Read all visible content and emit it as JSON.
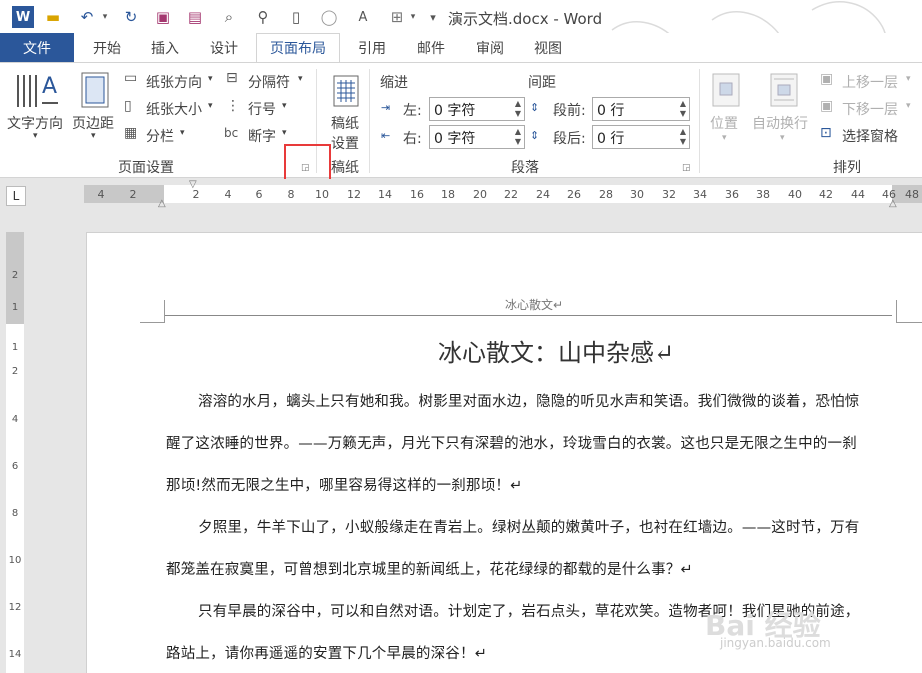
{
  "titlebar": {
    "doc_title": "演示文档.docx - Word",
    "quick_access": [
      "word-logo-icon",
      "open-icon",
      "undo-icon",
      "redo-icon",
      "save-icon",
      "save-as-icon",
      "print-preview-icon",
      "find-icon",
      "new-icon",
      "circle-icon",
      "style-icon",
      "border-icon",
      "customize-icon"
    ]
  },
  "tabs": {
    "file": "文件",
    "items": [
      "开始",
      "插入",
      "设计",
      "页面布局",
      "引用",
      "邮件",
      "审阅",
      "视图"
    ],
    "active": "页面布局"
  },
  "ribbon": {
    "page_setup": {
      "text_direction": "文字方向",
      "margins": "页边距",
      "orientation": "纸张方向",
      "size": "纸张大小",
      "columns": "分栏",
      "breaks": "分隔符",
      "line_numbers": "行号",
      "hyphenation": "断字",
      "group_label": "页面设置"
    },
    "draft": {
      "line1": "稿纸",
      "line2": "设置",
      "group_label": "稿纸"
    },
    "paragraph": {
      "indent_title": "缩进",
      "spacing_title": "间距",
      "left_label": "左:",
      "left_value": "0 字符",
      "right_label": "右:",
      "right_value": "0 字符",
      "before_label": "段前:",
      "before_value": "0 行",
      "after_label": "段后:",
      "after_value": "0 行",
      "group_label": "段落"
    },
    "arrange": {
      "position": "位置",
      "wrap": "自动换行",
      "bring_forward": "上移一层",
      "send_backward": "下移一层",
      "selection_pane": "选择窗格",
      "group_label": "排列"
    }
  },
  "ruler": {
    "tab_selector": "L",
    "h_left": [
      "4",
      "2"
    ],
    "h_right": [
      "2",
      "4",
      "6",
      "8",
      "10",
      "12",
      "14",
      "16",
      "18",
      "20",
      "22",
      "24",
      "26",
      "28",
      "30",
      "32",
      "34",
      "36",
      "38",
      "40",
      "42",
      "44",
      "46",
      "48"
    ],
    "v_top": [
      "2",
      "1"
    ],
    "v_body": [
      "1",
      "2",
      "4",
      "6",
      "8",
      "10",
      "12",
      "14"
    ]
  },
  "document": {
    "header": "冰心散文↵",
    "title": "冰心散文：山中杂感↵",
    "lines": [
      "溶溶的水月，螭头上只有她和我。树影里对面水边，隐隐的听见水声和笑语。我们微微的谈着，恐怕惊",
      "醒了这浓睡的世界。——万籁无声，月光下只有深碧的池水，玲珑雪白的衣裳。这也只是无限之生中的一刹",
      "那顷!然而无限之生中，哪里容易得这样的一刹那顷！↵",
      "夕照里，牛羊下山了，小蚁般缘走在青岩上。绿树丛颠的嫩黄叶子，也衬在红墙边。——这时节，万有",
      "都笼盖在寂寞里，可曾想到北京城里的新闻纸上，花花绿绿的都载的是什么事？↵",
      "只有早晨的深谷中，可以和自然对语。计划定了，岩石点头，草花欢笑。造物者呵！我们星驰的前途，",
      "路站上，请你再遥遥的安置下几个早晨的深谷！↵"
    ],
    "watermark": "Bai 经验",
    "watermark_sub": "jingyan.baidu.com"
  }
}
